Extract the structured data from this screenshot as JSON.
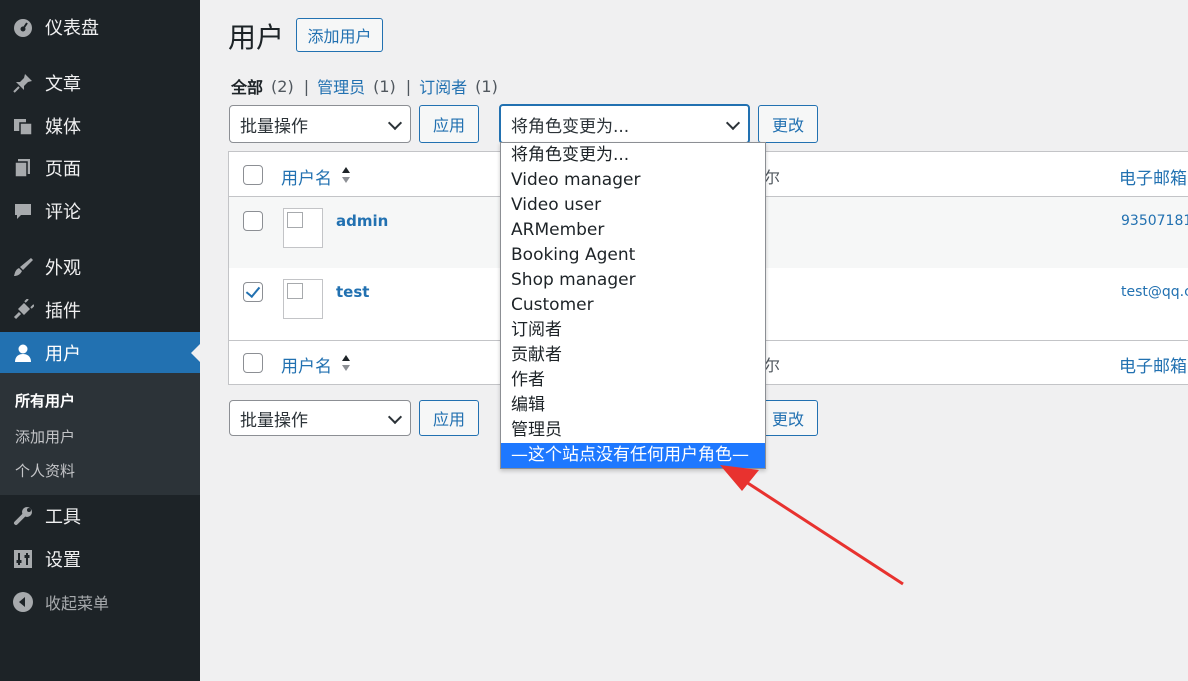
{
  "sidebar": {
    "items": [
      {
        "label": "仪表盘",
        "icon": "dashboard-icon"
      },
      {
        "label": "文章",
        "icon": "pin-icon"
      },
      {
        "label": "媒体",
        "icon": "media-icon"
      },
      {
        "label": "页面",
        "icon": "pages-icon"
      },
      {
        "label": "评论",
        "icon": "comment-icon"
      },
      {
        "label": "外观",
        "icon": "brush-icon"
      },
      {
        "label": "插件",
        "icon": "plugin-icon"
      },
      {
        "label": "用户",
        "icon": "user-icon"
      },
      {
        "label": "工具",
        "icon": "wrench-icon"
      },
      {
        "label": "设置",
        "icon": "settings-icon"
      }
    ],
    "submenu": [
      "所有用户",
      "添加用户",
      "个人资料"
    ],
    "collapse_label": "收起菜单",
    "active_color": "#2271b1"
  },
  "header": {
    "title": "用户",
    "add_button": "添加用户"
  },
  "filters": {
    "all": "全部",
    "all_count": "(2)",
    "admins": "管理员",
    "admins_count": "(1)",
    "subscribers": "订阅者",
    "subscribers_count": "(1)",
    "separator": "|"
  },
  "bulk": {
    "select_value": "批量操作",
    "apply_label": "应用",
    "role_select_value": "将角色变更为...",
    "change_label": "更改"
  },
  "table": {
    "col_username": "用户名",
    "col_name_fragment": "尔",
    "col_email": "电子邮箱",
    "rows": [
      {
        "username": "admin",
        "email": "93507181",
        "checked": false
      },
      {
        "username": "test",
        "email": "test@qq.c",
        "checked": true
      }
    ]
  },
  "dropdown": {
    "options": [
      "将角色变更为...",
      "Video manager",
      "Video user",
      "ARMember",
      "Booking Agent",
      "Shop manager",
      "Customer",
      "订阅者",
      "贡献者",
      "作者",
      "编辑",
      "管理员",
      "—这个站点没有任何用户角色—"
    ],
    "selected_index": 12,
    "selected_color": "#1e78ff"
  },
  "annotation": {
    "arrow_color": "#e8322f"
  }
}
